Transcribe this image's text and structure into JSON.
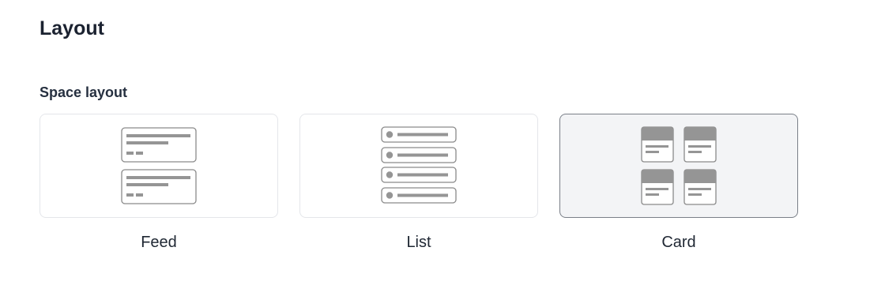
{
  "section": {
    "title": "Layout"
  },
  "space_layout": {
    "label": "Space layout",
    "selected": "Card",
    "options": [
      {
        "label": "Feed",
        "icon": "feed-layout-icon"
      },
      {
        "label": "List",
        "icon": "list-layout-icon"
      },
      {
        "label": "Card",
        "icon": "card-layout-icon"
      }
    ]
  },
  "colors": {
    "selected_bg": "#f3f4f6",
    "selected_border": "#7a7f88",
    "border": "#e4e6ea",
    "icon_gray": "#959595"
  }
}
